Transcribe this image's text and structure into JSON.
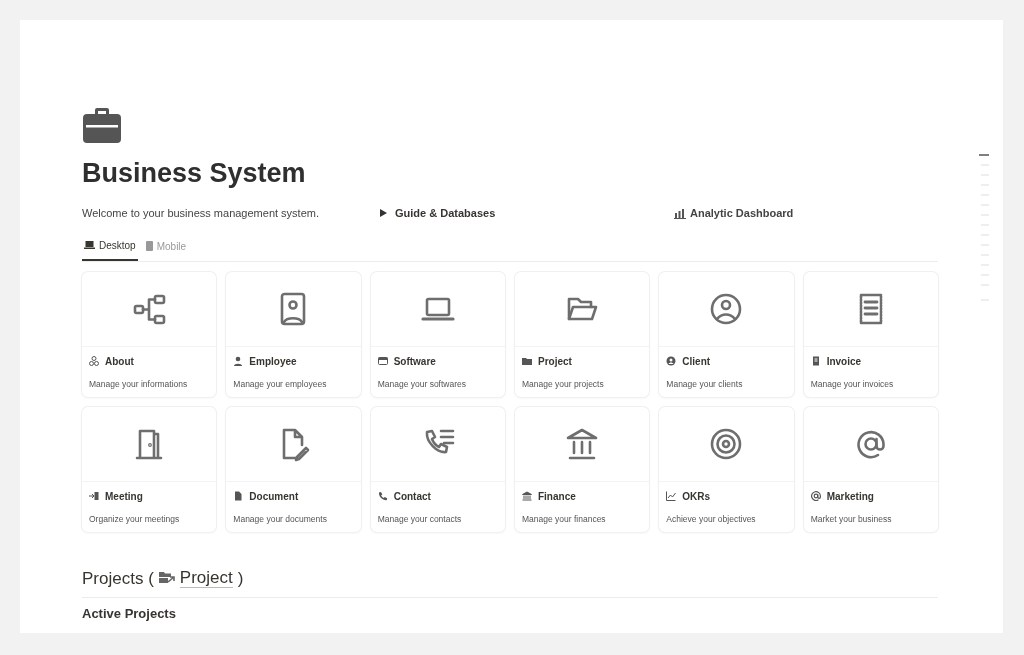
{
  "page": {
    "title": "Business System",
    "intro": "Welcome to your business management system.",
    "toggle": "Guide & Databases",
    "dashboard_link": "Analytic Dashboard"
  },
  "tabs": [
    {
      "label": "Desktop",
      "selected": true
    },
    {
      "label": "Mobile",
      "selected": false
    }
  ],
  "cards": [
    {
      "title": "About",
      "description": "Manage your informations"
    },
    {
      "title": "Employee",
      "description": "Manage your employees"
    },
    {
      "title": "Software",
      "description": "Manage your softwares"
    },
    {
      "title": "Project",
      "description": "Manage your projects"
    },
    {
      "title": "Client",
      "description": "Manage your clients"
    },
    {
      "title": "Invoice",
      "description": "Manage your invoices"
    },
    {
      "title": "Meeting",
      "description": "Organize your meetings"
    },
    {
      "title": "Document",
      "description": "Manage your documents"
    },
    {
      "title": "Contact",
      "description": "Manage your contacts"
    },
    {
      "title": "Finance",
      "description": "Manage your finances"
    },
    {
      "title": "OKRs",
      "description": "Achieve your objectives"
    },
    {
      "title": "Marketing",
      "description": "Market your business"
    }
  ],
  "projects_section": {
    "heading_prefix": "Projects (",
    "link": "Project",
    "heading_suffix": ")",
    "subheading": "Active Projects"
  }
}
